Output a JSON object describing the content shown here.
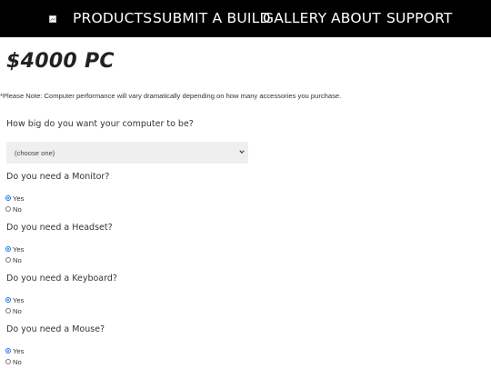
{
  "nav": {
    "items": [
      {
        "label": "PRODUCTS"
      },
      {
        "label": "SUBMIT A BUILD"
      },
      {
        "label": "GALLERY"
      },
      {
        "label": "ABOUT"
      },
      {
        "label": "SUPPORT"
      }
    ]
  },
  "page": {
    "title": "$4000 PC",
    "note": "*Please Note: Computer performance will vary dramatically depending on how many accessories you purchase."
  },
  "form": {
    "size_question": "How big do you want your computer to be?",
    "size_select": {
      "value": "(choose one)"
    },
    "questions": [
      {
        "label": "Do you need a Monitor?",
        "options": [
          {
            "label": "Yes",
            "checked": true
          },
          {
            "label": "No",
            "checked": false
          }
        ]
      },
      {
        "label": "Do you need a Headset?",
        "options": [
          {
            "label": "Yes",
            "checked": true
          },
          {
            "label": "No",
            "checked": false
          }
        ]
      },
      {
        "label": "Do you need a Keyboard?",
        "options": [
          {
            "label": "Yes",
            "checked": true
          },
          {
            "label": "No",
            "checked": false
          }
        ]
      },
      {
        "label": "Do you need a Mouse?",
        "options": [
          {
            "label": "Yes",
            "checked": true
          },
          {
            "label": "No",
            "checked": false
          }
        ]
      }
    ]
  }
}
